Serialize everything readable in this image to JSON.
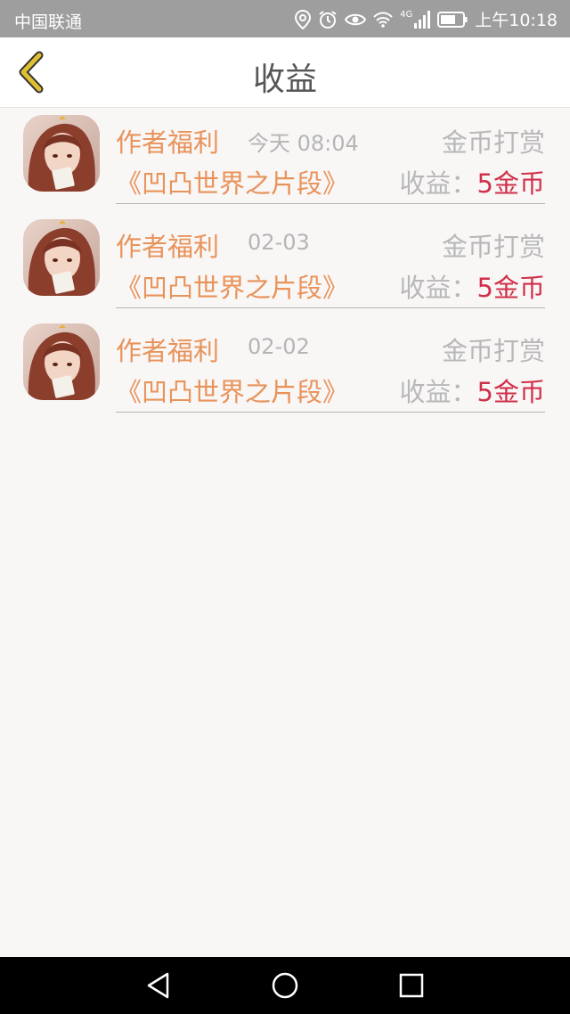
{
  "status_bar": {
    "carrier": "中国联通",
    "time": "上午10:18",
    "network": "4G",
    "icons": [
      "location-icon",
      "alarm-icon",
      "eye-icon",
      "wifi-icon",
      "signal-icon",
      "battery-icon"
    ]
  },
  "header": {
    "title": "收益",
    "back_icon": "chevron-left-icon"
  },
  "records": [
    {
      "author_label": "作者福利",
      "time": "今天 08:04",
      "type": "金币打赏",
      "book": "《凹凸世界之片段》",
      "earnings_label": "收益：",
      "earnings_amount": "5金币"
    },
    {
      "author_label": "作者福利",
      "time": "02-03",
      "type": "金币打赏",
      "book": "《凹凸世界之片段》",
      "earnings_label": "收益：",
      "earnings_amount": "5金币"
    },
    {
      "author_label": "作者福利",
      "time": "02-02",
      "type": "金币打赏",
      "book": "《凹凸世界之片段》",
      "earnings_label": "收益：",
      "earnings_amount": "5金币"
    }
  ],
  "nav_bar": {
    "icons": [
      "back-triangle-icon",
      "home-circle-icon",
      "recents-square-icon"
    ]
  },
  "colors": {
    "accent": "#e8935a",
    "amount": "#d0304a",
    "muted": "#b8b8b8",
    "back_chevron": "#e0c030",
    "status_bar": "#9e9e9e"
  }
}
